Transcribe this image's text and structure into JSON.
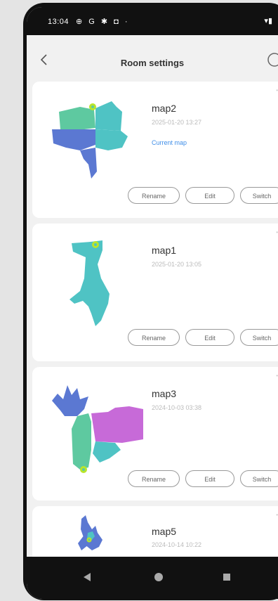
{
  "status": {
    "time": "13:04",
    "icons": "⊕ G ✱ ◘ ·",
    "right_icons": "▾▮"
  },
  "header": {
    "title": "Room settings",
    "back_icon": "back-arrow-icon",
    "more_icon": "info-icon"
  },
  "maps": [
    {
      "name": "map2",
      "date": "2025-01-20 13:27",
      "current": "Current map",
      "rename": "Rename",
      "edit": "Edit",
      "switch": "Switch"
    },
    {
      "name": "map1",
      "date": "2025-01-20 13:05",
      "rename": "Rename",
      "edit": "Edit",
      "switch": "Switch"
    },
    {
      "name": "map3",
      "date": "2024-10-03 03:38",
      "rename": "Rename",
      "edit": "Edit",
      "switch": "Switch"
    },
    {
      "name": "map5",
      "date": "2024-10-14 10:22"
    }
  ],
  "colors": {
    "accent": "#3f8ee8",
    "map_teal": "#4fc3c4",
    "map_blue": "#5b78d2",
    "map_green": "#5ec9a0",
    "map_purple": "#c76ad8"
  }
}
